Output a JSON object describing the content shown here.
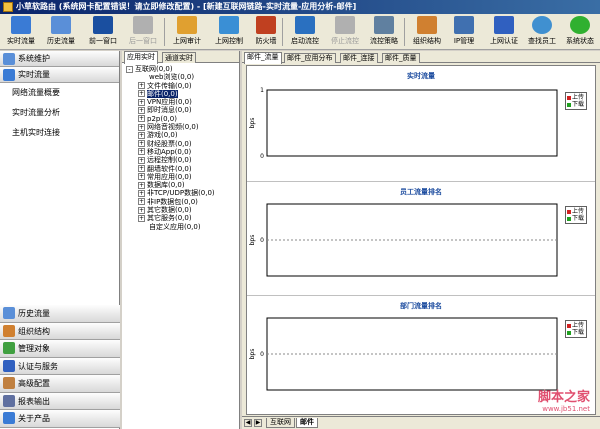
{
  "window": {
    "title": "小草软路由 (系统网卡配置错误！请立即修改配置) - [新建互联网链路-实时流量-应用分析-邮件]"
  },
  "toolbar": {
    "buttons": [
      {
        "label": "实时流量",
        "icon": "monitor-icon",
        "color": "#3a7bd5",
        "enabled": true
      },
      {
        "label": "历史流量",
        "icon": "history-icon",
        "color": "#5a8fd8",
        "enabled": true
      },
      {
        "label": "前一窗口",
        "icon": "back-arrow-icon",
        "color": "#1a4fa0",
        "enabled": true
      },
      {
        "label": "后一窗口",
        "icon": "forward-arrow-icon",
        "color": "#b0b0b0",
        "enabled": false
      },
      {
        "label": "上网审计",
        "icon": "audit-icon",
        "color": "#e0a030",
        "enabled": true
      },
      {
        "label": "上网控制",
        "icon": "control-icon",
        "color": "#3a8fd5",
        "enabled": true
      },
      {
        "label": "防火墙",
        "icon": "firewall-icon",
        "color": "#c04020",
        "enabled": true
      },
      {
        "label": "启动流控",
        "icon": "play-icon",
        "color": "#2a70c0",
        "enabled": true
      },
      {
        "label": "停止流控",
        "icon": "pause-icon",
        "color": "#b0b0b0",
        "enabled": false
      },
      {
        "label": "流控策略",
        "icon": "tools-icon",
        "color": "#6080a0",
        "enabled": true
      },
      {
        "label": "组织结构",
        "icon": "org-chart-icon",
        "color": "#d08030",
        "enabled": true
      },
      {
        "label": "IP管理",
        "icon": "ip-manage-icon",
        "color": "#4070b0",
        "enabled": true
      },
      {
        "label": "上网认证",
        "icon": "shield-auth-icon",
        "color": "#3060c0",
        "enabled": true
      },
      {
        "label": "查找员工",
        "icon": "search-icon",
        "color": "#4090d0",
        "enabled": true
      },
      {
        "label": "系统状态",
        "icon": "status-light-icon",
        "color": "#30b030",
        "enabled": true
      }
    ]
  },
  "left_nav": {
    "top_sections": [
      {
        "label": "系统维护",
        "icon": "maintenance-icon"
      },
      {
        "label": "实时流量",
        "icon": "realtime-icon"
      }
    ],
    "items": [
      "网络流量概要",
      "实时流量分析",
      "主机实时连接"
    ],
    "bottom_sections": [
      {
        "label": "历史流量",
        "icon": "history-icon"
      },
      {
        "label": "组织结构",
        "icon": "org-chart-icon"
      },
      {
        "label": "管理对象",
        "icon": "objects-icon"
      },
      {
        "label": "认证与服务",
        "icon": "auth-service-icon"
      },
      {
        "label": "高级配置",
        "icon": "advanced-config-icon"
      },
      {
        "label": "报表输出",
        "icon": "report-icon"
      },
      {
        "label": "关于产品",
        "icon": "about-icon"
      }
    ]
  },
  "tree_panel": {
    "tabs": [
      "应用实时",
      "通道实时"
    ],
    "nodes": [
      {
        "label": "互联网(0,0)",
        "depth": 0,
        "expander": "-",
        "selected": false
      },
      {
        "label": "web浏览(0,0)",
        "depth": 1,
        "expander": "",
        "selected": false
      },
      {
        "label": "文件传输(0,0)",
        "depth": 1,
        "expander": "+",
        "selected": false
      },
      {
        "label": "邮件(0,0)",
        "depth": 1,
        "expander": "+",
        "selected": true
      },
      {
        "label": "VPN应用(0,0)",
        "depth": 1,
        "expander": "+",
        "selected": false
      },
      {
        "label": "即时消息(0,0)",
        "depth": 1,
        "expander": "+",
        "selected": false
      },
      {
        "label": "p2p(0,0)",
        "depth": 1,
        "expander": "+",
        "selected": false
      },
      {
        "label": "网络音视频(0,0)",
        "depth": 1,
        "expander": "+",
        "selected": false
      },
      {
        "label": "游戏(0,0)",
        "depth": 1,
        "expander": "+",
        "selected": false
      },
      {
        "label": "财经股票(0,0)",
        "depth": 1,
        "expander": "+",
        "selected": false
      },
      {
        "label": "移动App(0,0)",
        "depth": 1,
        "expander": "+",
        "selected": false
      },
      {
        "label": "远程控制(0,0)",
        "depth": 1,
        "expander": "+",
        "selected": false
      },
      {
        "label": "翻墙软件(0,0)",
        "depth": 1,
        "expander": "+",
        "selected": false
      },
      {
        "label": "常用应用(0,0)",
        "depth": 1,
        "expander": "+",
        "selected": false
      },
      {
        "label": "数据库(0,0)",
        "depth": 1,
        "expander": "+",
        "selected": false
      },
      {
        "label": "非TCP/UDP数据(0,0)",
        "depth": 1,
        "expander": "+",
        "selected": false
      },
      {
        "label": "非IP数据包(0,0)",
        "depth": 1,
        "expander": "+",
        "selected": false
      },
      {
        "label": "其它数据(0,0)",
        "depth": 1,
        "expander": "+",
        "selected": false
      },
      {
        "label": "其它服务(0,0)",
        "depth": 1,
        "expander": "+",
        "selected": false
      },
      {
        "label": "自定义应用(0,0)",
        "depth": 1,
        "expander": "",
        "selected": false
      }
    ]
  },
  "chart_tabs": [
    "邮件_流量",
    "邮件_应用分布",
    "邮件_连接",
    "邮件_质量"
  ],
  "bottom_tabs": [
    "互联网",
    "邮件"
  ],
  "legend_colors": {
    "upload": "#d02020",
    "download": "#20a020"
  },
  "chart_data": [
    {
      "type": "line",
      "title": "实时流量",
      "ylabel": "bps",
      "yticks": [
        "1",
        "0"
      ],
      "ylim": [
        0,
        1
      ],
      "series": [
        {
          "name": "上传",
          "values": []
        },
        {
          "name": "下载",
          "values": []
        }
      ],
      "legend": "top-right",
      "grid": false
    },
    {
      "type": "bar",
      "title": "员工流量排名",
      "ylabel": "bps",
      "yticks": [
        "0"
      ],
      "series": [
        {
          "name": "上传",
          "values": []
        },
        {
          "name": "下载",
          "values": []
        }
      ],
      "legend": "top-right",
      "grid": true
    },
    {
      "type": "bar",
      "title": "部门流量排名",
      "ylabel": "bps",
      "yticks": [
        "0"
      ],
      "series": [
        {
          "name": "上传",
          "values": []
        },
        {
          "name": "下载",
          "values": []
        }
      ],
      "legend": "top-right",
      "grid": true
    }
  ],
  "watermark": {
    "text": "脚本之家",
    "url": "www.jb51.net"
  }
}
